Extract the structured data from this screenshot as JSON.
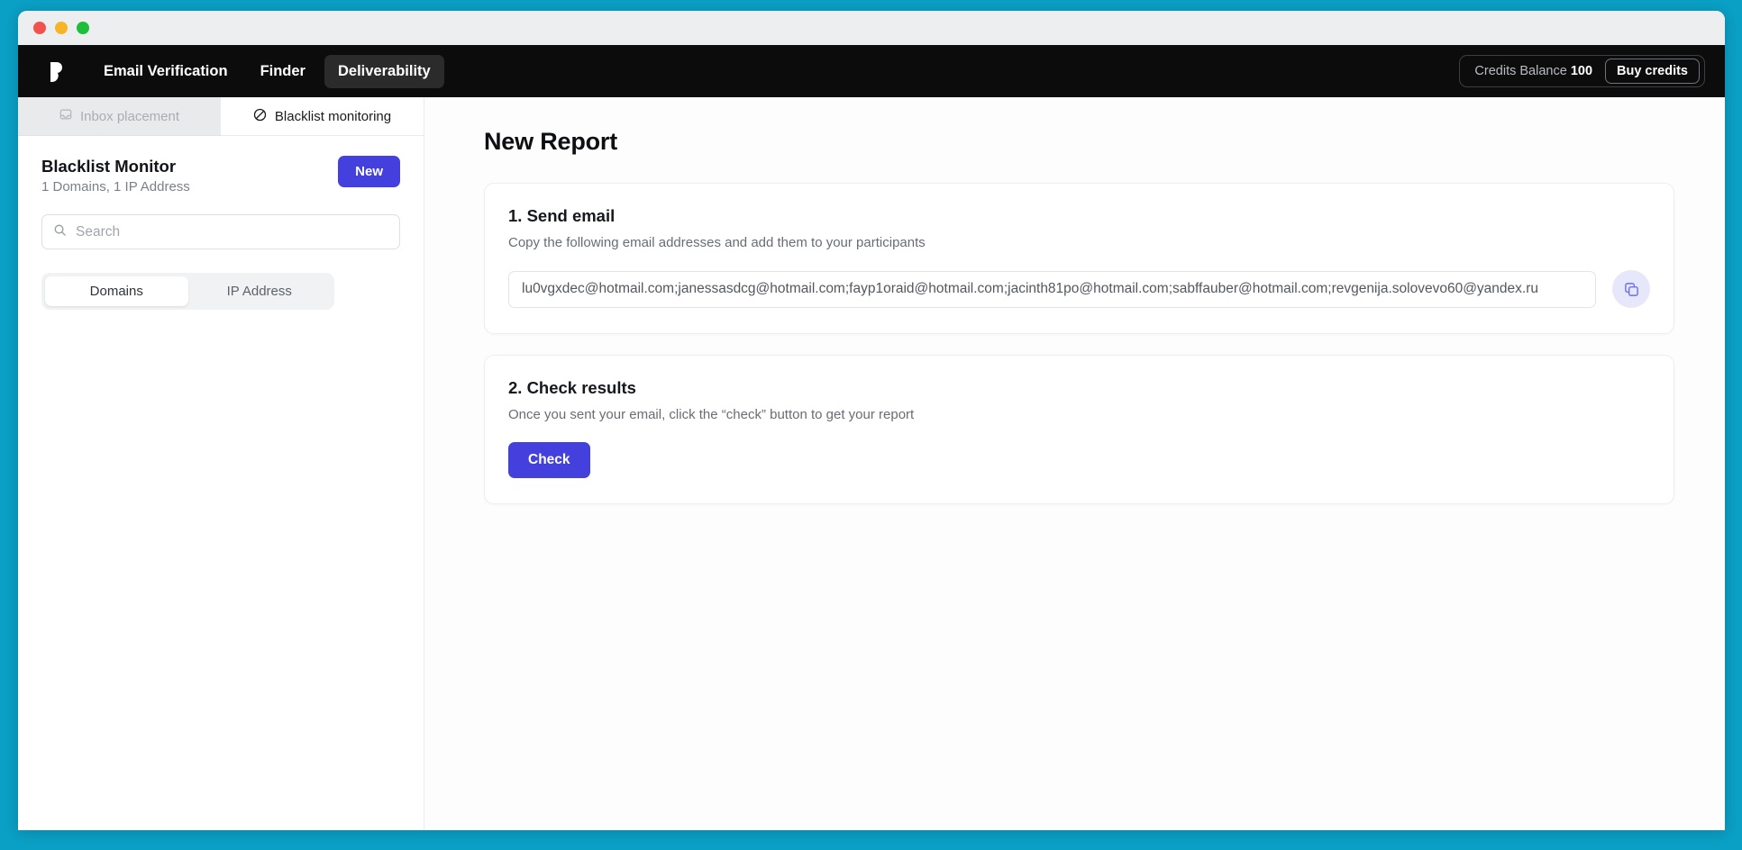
{
  "window": {
    "traffic_lights": [
      "close",
      "minimize",
      "zoom"
    ]
  },
  "topnav": {
    "logo_name": "hunter-logo-icon",
    "links": [
      {
        "label": "Email Verification",
        "active": false
      },
      {
        "label": "Finder",
        "active": false
      },
      {
        "label": "Deliverability",
        "active": true
      }
    ],
    "credits_label": "Credits Balance",
    "credits_value": "100",
    "buy_credits_label": "Buy credits"
  },
  "sidebar": {
    "tabs": [
      {
        "label": "Inbox placement",
        "icon": "inbox-icon",
        "active": false
      },
      {
        "label": "Blacklist monitoring",
        "icon": "blocked-circle-icon",
        "active": true
      }
    ],
    "monitor": {
      "title": "Blacklist Monitor",
      "subtitle": "1 Domains, 1 IP Address",
      "new_button": "New"
    },
    "search": {
      "value": "",
      "placeholder": "Search",
      "icon": "search-icon"
    },
    "segments": [
      {
        "label": "Domains",
        "active": true
      },
      {
        "label": "IP Address",
        "active": false
      }
    ]
  },
  "main": {
    "page_title": "New Report",
    "steps": [
      {
        "title": "1. Send email",
        "subtitle": "Copy the following email addresses and add them to your participants",
        "email_value": "lu0vgxdec@hotmail.com;janessasdcg@hotmail.com;fayp1oraid@hotmail.com;jacinth81po@hotmail.com;sabffauber@hotmail.com;revgenija.solovevo60@yandex.ru",
        "email_placeholder": "",
        "copy_icon": "copy-icon"
      },
      {
        "title": "2. Check results",
        "subtitle": "Once you sent your email, click the “check” button to get your report",
        "check_button": "Check"
      }
    ]
  },
  "colors": {
    "desktop_background": "#0a9fc4",
    "accent_purple": "#4340dd",
    "topnav_background": "#0c0c0c",
    "copy_button_background": "#e6e7fb"
  }
}
